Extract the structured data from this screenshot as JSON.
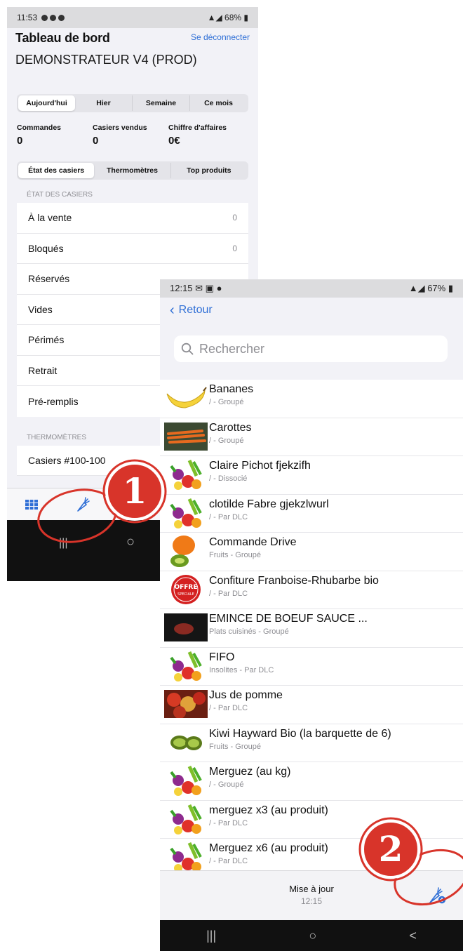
{
  "screen1": {
    "status": {
      "time": "11:53",
      "battery": "68%"
    },
    "title": "Tableau de bord",
    "logout": "Se déconnecter",
    "site": "DEMONSTRATEUR V4 (PROD)",
    "periods": [
      "Aujourd'hui",
      "Hier",
      "Semaine",
      "Ce mois"
    ],
    "selected_period": "Aujourd'hui",
    "stats": [
      {
        "label": "Commandes",
        "value": "0"
      },
      {
        "label": "Casiers vendus",
        "value": "0"
      },
      {
        "label": "Chiffre d'affaires",
        "value": "0€"
      }
    ],
    "tabs": [
      "État des casiers",
      "Thermomètres",
      "Top produits"
    ],
    "section_lockers": "ÉTAT DES CASIERS",
    "lockers": [
      {
        "label": "À la vente",
        "value": "0"
      },
      {
        "label": "Bloqués",
        "value": "0"
      },
      {
        "label": "Réservés",
        "value": ""
      },
      {
        "label": "Vides",
        "value": ""
      },
      {
        "label": "Périmés",
        "value": ""
      },
      {
        "label": "Retrait",
        "value": ""
      },
      {
        "label": "Pré-remplis",
        "value": ""
      }
    ],
    "section_thermo": "THERMOMÈTRES",
    "thermo_row": "Casiers #100-100",
    "icons": [
      "grid-icon",
      "carrot-icon"
    ]
  },
  "screen2": {
    "status": {
      "time": "12:15",
      "battery": "67%"
    },
    "back": "Retour",
    "search_placeholder": "Rechercher",
    "products": [
      {
        "name": "Bananes",
        "sub": "/ - Groupé",
        "thumb": "banana"
      },
      {
        "name": "Carottes",
        "sub": "/ - Groupé",
        "thumb": "carrots"
      },
      {
        "name": "Claire Pichot fjekzifh",
        "sub": "/ - Dissocié",
        "thumb": "veggies"
      },
      {
        "name": "clotilde Fabre gjekzlwurl",
        "sub": "/ - Par DLC",
        "thumb": "veggies"
      },
      {
        "name": "Commande Drive",
        "sub": "Fruits - Groupé",
        "thumb": "pepper-kiwi"
      },
      {
        "name": "Confiture Franboise-Rhubarbe bio",
        "sub": "/ - Par DLC",
        "thumb": "offer"
      },
      {
        "name": "EMINCE DE BOEUF SAUCE ...",
        "sub": "Plats cuisinés - Groupé",
        "thumb": "beef"
      },
      {
        "name": "FIFO",
        "sub": "Insolites - Par DLC",
        "thumb": "veggies"
      },
      {
        "name": "Jus de pomme",
        "sub": "/ - Par DLC",
        "thumb": "apples"
      },
      {
        "name": "Kiwi Hayward Bio (la barquette de 6)",
        "sub": "Fruits - Groupé",
        "thumb": "kiwi"
      },
      {
        "name": "Merguez (au kg)",
        "sub": "/ - Groupé",
        "thumb": "veggies"
      },
      {
        "name": "merguez x3 (au produit)",
        "sub": "/ - Par DLC",
        "thumb": "veggies"
      },
      {
        "name": "Merguez x6 (au produit)",
        "sub": "/ - Par DLC",
        "thumb": "veggies"
      }
    ],
    "update_label": "Mise à jour",
    "update_time": "12:15",
    "nav": [
      "|||",
      "○",
      "<"
    ]
  },
  "annotations": [
    {
      "number": "1",
      "color": "#d8342a"
    },
    {
      "number": "2",
      "color": "#d8342a"
    }
  ]
}
